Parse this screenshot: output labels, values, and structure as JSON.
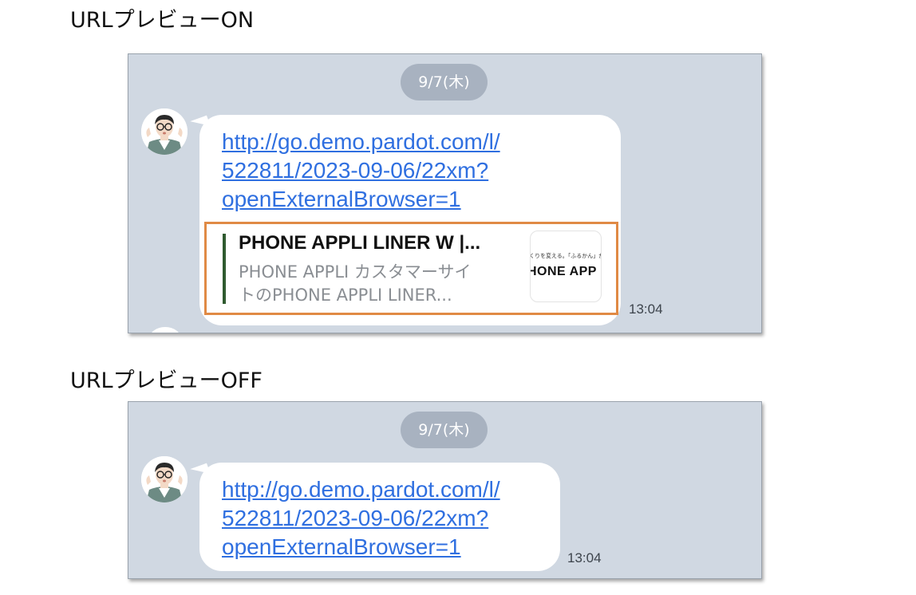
{
  "sections": {
    "on_label": "URLプレビューON",
    "off_label": "URLプレビューOFF"
  },
  "chat": {
    "date": "9/7(木)",
    "url_lines": [
      "http://go.demo.pardot.com/l/",
      "522811/2023-09-06/22xm?",
      "openExternalBrowser=1"
    ],
    "time": "13:04"
  },
  "preview": {
    "title": "PHONE APPLI LINER W |...",
    "desc_lines": [
      "PHONE APPLI カスタマーサイ",
      "トのPHONE APPLI LINER..."
    ],
    "thumb_small": "くりを変える。「ふるかん」が変",
    "thumb_big": "HONE APP"
  },
  "colors": {
    "chat_background": "#d0d8e2",
    "link": "#2f6fe0",
    "preview_highlight": "#e08a45",
    "preview_accent_bar": "#2f5a2f"
  },
  "icons": [
    "avatar-icon"
  ]
}
